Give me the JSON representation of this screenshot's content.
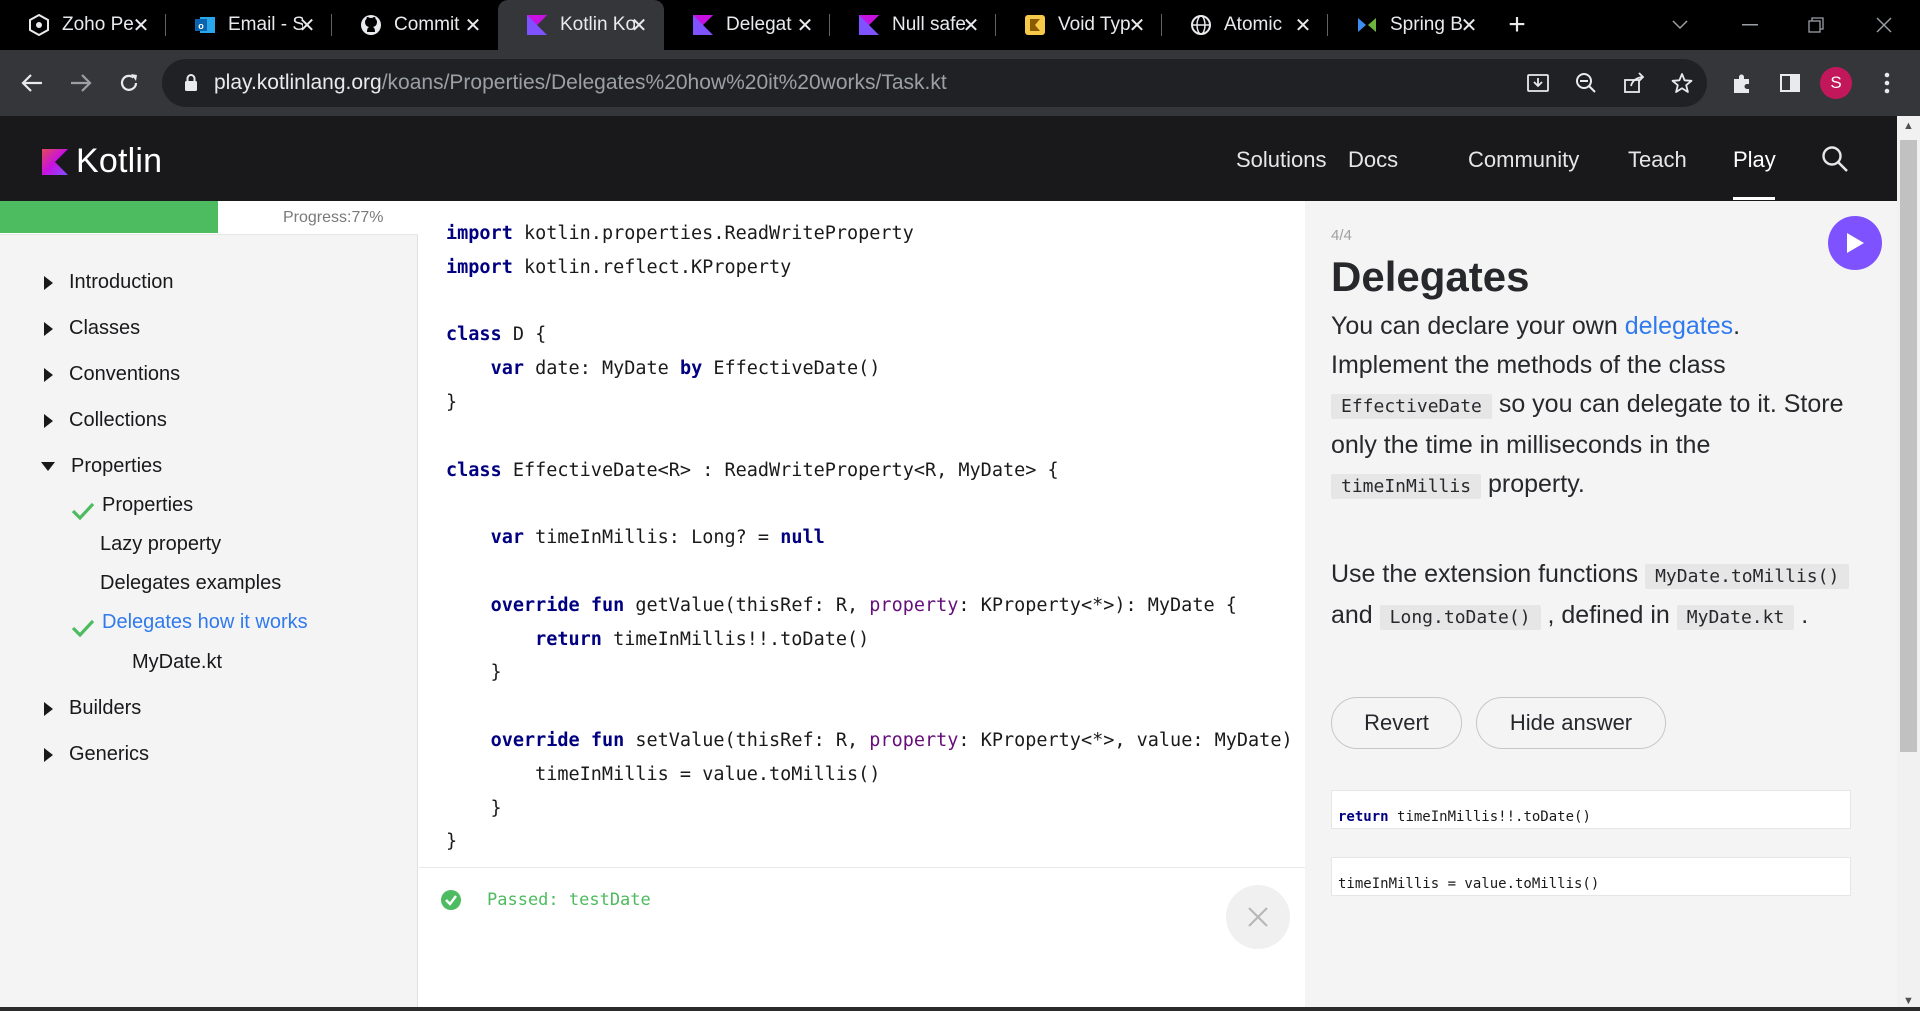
{
  "browser": {
    "tabs": [
      {
        "label": "Zoho Pe",
        "icon": "zoho-icon"
      },
      {
        "label": "Email - S",
        "icon": "outlook-icon"
      },
      {
        "label": "Commit",
        "icon": "github-icon"
      },
      {
        "label": "Kotlin Ko",
        "icon": "kotlin-icon",
        "active": true
      },
      {
        "label": "Delegat",
        "icon": "kotlin-icon"
      },
      {
        "label": "Null safe",
        "icon": "kotlin-icon"
      },
      {
        "label": "Void Typ",
        "icon": "kotlin-yellow-icon"
      },
      {
        "label": "Atomic",
        "icon": "globe-icon"
      },
      {
        "label": "Spring B",
        "icon": "spring-icon"
      }
    ],
    "url_host": "play.kotlinlang.org",
    "url_path": "/koans/Properties/Delegates%20how%20it%20works/Task.kt",
    "profile_initial": "S"
  },
  "header": {
    "logo_text": "Kotlin",
    "nav": [
      "Solutions",
      "Docs",
      "Community",
      "Teach",
      "Play"
    ],
    "active_nav": "Play"
  },
  "sidebar": {
    "progress_label": "Progress:77%",
    "progress": 0.77,
    "items": [
      {
        "label": "Introduction"
      },
      {
        "label": "Classes"
      },
      {
        "label": "Conventions"
      },
      {
        "label": "Collections"
      },
      {
        "label": "Properties"
      },
      {
        "label": "Properties"
      },
      {
        "label": "Lazy property"
      },
      {
        "label": "Delegates examples"
      },
      {
        "label": "Delegates how it works"
      },
      {
        "label": "MyDate.kt"
      },
      {
        "label": "Builders"
      },
      {
        "label": "Generics"
      }
    ]
  },
  "editor": {
    "code": [
      "import kotlin.properties.ReadWriteProperty",
      "import kotlin.reflect.KProperty",
      "",
      "class D {",
      "    var date: MyDate by EffectiveDate()",
      "}",
      "",
      "class EffectiveDate<R> : ReadWriteProperty<R, MyDate> {",
      "",
      "    var timeInMillis: Long? = null",
      "",
      "    override fun getValue(thisRef: R, property: KProperty<*>): MyDate {",
      "        return timeInMillis!!.toDate()",
      "    }",
      "",
      "    override fun setValue(thisRef: R, property: KProperty<*>, value: MyDate)",
      "        timeInMillis = value.toMillis()",
      "    }",
      "}"
    ],
    "result_text": "Passed: testDate"
  },
  "task": {
    "counter": "4/4",
    "title": "Delegates",
    "p1_a": "You can declare your own ",
    "p1_link": "delegates",
    "p1_b": ". Implement the methods of the class ",
    "p1_code1": "EffectiveDate",
    "p1_c": " so you can delegate to it. Store only the time in milliseconds in the ",
    "p1_code2": "timeInMillis",
    "p1_d": " property.",
    "p2_a": "Use the extension functions ",
    "p2_code1": "MyDate.toMillis()",
    "p2_b": " and ",
    "p2_code2": "Long.toDate()",
    "p2_c": " , defined in ",
    "p2_code3": "MyDate.kt",
    "p2_d": " .",
    "revert_label": "Revert",
    "hide_answer_label": "Hide answer",
    "answers": [
      "return timeInMillis!!.toDate()",
      "timeInMillis = value.toMillis()"
    ]
  },
  "colors": {
    "kotlin_purple": "#7f52ff",
    "progress_green": "#4dbb5f",
    "link_blue": "#307aed"
  }
}
